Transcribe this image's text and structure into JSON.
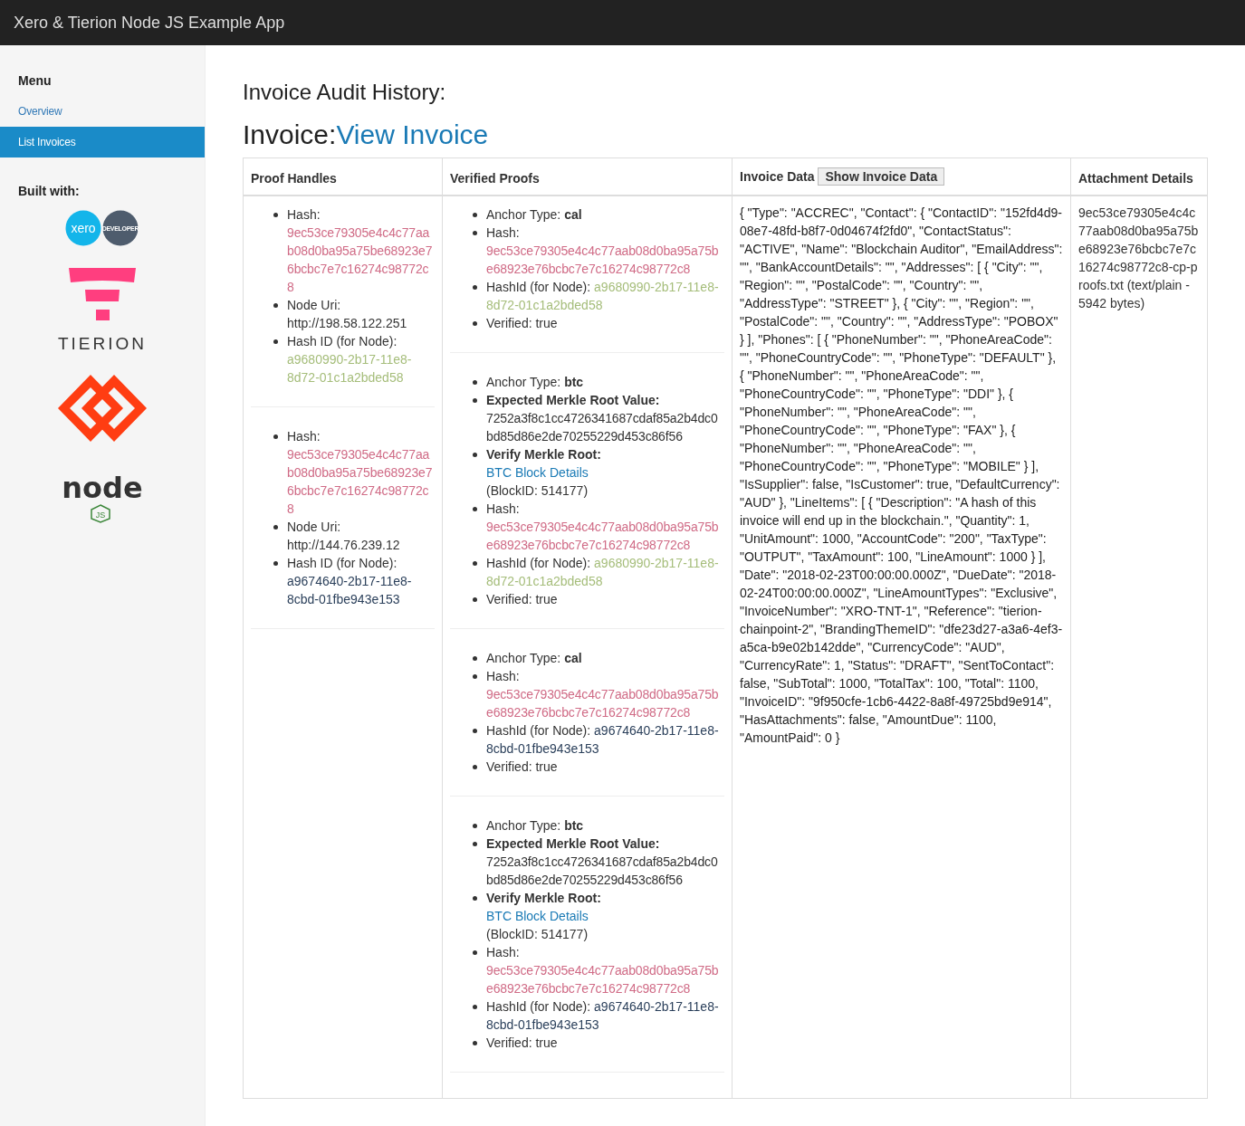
{
  "app_bar": {
    "title": "Xero & Tierion Node JS Example App"
  },
  "sidebar": {
    "menu_heading": "Menu",
    "items": [
      {
        "label": "Overview",
        "selected": false
      },
      {
        "label": "List Invoices",
        "selected": true
      }
    ],
    "built_with_heading": "Built with:",
    "logos": [
      {
        "kind": "xero",
        "text": "xero",
        "badge": "DEVELOPER"
      },
      {
        "kind": "tierion",
        "text": "TIERION"
      },
      {
        "kind": "chainpoint"
      },
      {
        "kind": "node",
        "text": "node",
        "badge": "JS"
      }
    ]
  },
  "heading": "Invoice Audit History:",
  "invoice_heading": {
    "label": "Invoice:",
    "link": "View Invoice"
  },
  "table": {
    "columns": [
      "Proof Handles",
      "Verified Proofs",
      "Invoice Data",
      "Attachment Details"
    ],
    "show_button": "Show Invoice Data",
    "proof_handles": [
      {
        "lines": [
          {
            "kind": "hash",
            "label": "Hash:",
            "value": "9ec53ce79305e4c4c77aab08d0ba95a75be68923e76bcbc7e7c16274c98772c8"
          },
          {
            "kind": "node_uri",
            "label": "Node Uri:",
            "value": "http://198.58.122.251"
          },
          {
            "kind": "hash_id",
            "label": "Hash ID (for Node):",
            "value": "a9680990-2b17-11e8-8d72-01c1a2bded58",
            "highlighted": true
          }
        ]
      },
      {
        "lines": [
          {
            "kind": "hash",
            "label": "Hash:",
            "value": "9ec53ce79305e4c4c77aab08d0ba95a75be68923e76bcbc7e7c16274c98772c8"
          },
          {
            "kind": "node_uri",
            "label": "Node Uri:",
            "value": "http://144.76.239.12"
          },
          {
            "kind": "hash_id",
            "label": "Hash ID (for Node):",
            "value": "a9674640-2b17-11e8-8cbd-01fbe943e153",
            "highlighted": false
          }
        ]
      }
    ],
    "verified_proofs": [
      {
        "lines": [
          {
            "kind": "anchor",
            "text": "Anchor Type: **cal**"
          },
          {
            "kind": "hash",
            "label": "Hash:",
            "value": "9ec53ce79305e4c4c77aab08d0ba95a75be68923e76bcbc7e7c16274c98772c8"
          },
          {
            "kind": "hash_id",
            "label": "HashId (for Node):",
            "value": "a9680990-2b17-11e8-8d72-01c1a2bded58",
            "highlighted": true
          },
          {
            "kind": "verified",
            "text": "Verified: true"
          }
        ]
      },
      {
        "lines": [
          {
            "kind": "anchor",
            "text": "Anchor Type: **btc**"
          },
          {
            "kind": "merkle_value",
            "label": "Expected Merkle Root Value:",
            "value": "7252a3f8c1cc4726341687cdaf85a2b4dc0bd85d86e2de70255229d453c86f56"
          },
          {
            "kind": "merkle_verify",
            "label": "Verify Merkle Root:",
            "link": "BTC Block Details",
            "block": "(BlockID: 514177)"
          },
          {
            "kind": "hash",
            "label": "Hash:",
            "value": "9ec53ce79305e4c4c77aab08d0ba95a75be68923e76bcbc7e7c16274c98772c8"
          },
          {
            "kind": "hash_id",
            "label": "HashId (for Node):",
            "value": "a9680990-2b17-11e8-8d72-01c1a2bded58",
            "highlighted": true
          },
          {
            "kind": "verified",
            "text": "Verified: true"
          }
        ]
      },
      {
        "lines": [
          {
            "kind": "anchor",
            "text": "Anchor Type: **cal**"
          },
          {
            "kind": "hash",
            "label": "Hash:",
            "value": "9ec53ce79305e4c4c77aab08d0ba95a75be68923e76bcbc7e7c16274c98772c8"
          },
          {
            "kind": "hash_id",
            "label": "HashId (for Node):",
            "value": "a9674640-2b17-11e8-8cbd-01fbe943e153",
            "highlighted": false
          },
          {
            "kind": "verified",
            "text": "Verified: true"
          }
        ]
      },
      {
        "lines": [
          {
            "kind": "anchor",
            "text": "Anchor Type: **btc**"
          },
          {
            "kind": "merkle_value",
            "label": "Expected Merkle Root Value:",
            "value": "7252a3f8c1cc4726341687cdaf85a2b4dc0bd85d86e2de70255229d453c86f56"
          },
          {
            "kind": "merkle_verify",
            "label": "Verify Merkle Root:",
            "link": "BTC Block Details",
            "block": "(BlockID: 514177)"
          },
          {
            "kind": "hash",
            "label": "Hash:",
            "value": "9ec53ce79305e4c4c77aab08d0ba95a75be68923e76bcbc7e7c16274c98772c8"
          },
          {
            "kind": "hash_id",
            "label": "HashId (for Node):",
            "value": "a9674640-2b17-11e8-8cbd-01fbe943e153",
            "highlighted": false
          },
          {
            "kind": "verified",
            "text": "Verified: true"
          }
        ]
      }
    ],
    "invoice_data": "{ \"Type\": \"ACCREC\", \"Contact\": { \"ContactID\": \"152fd4d9-08e7-48fd-b8f7-0d04674f2fd0\", \"ContactStatus\": \"ACTIVE\", \"Name\": \"Blockchain Auditor\", \"EmailAddress\": \"\", \"BankAccountDetails\": \"\", \"Addresses\": [ { \"City\": \"\", \"Region\": \"\", \"PostalCode\": \"\", \"Country\": \"\", \"AddressType\": \"STREET\" }, { \"City\": \"\", \"Region\": \"\", \"PostalCode\": \"\", \"Country\": \"\", \"AddressType\": \"POBOX\" } ], \"Phones\": [ { \"PhoneNumber\": \"\", \"PhoneAreaCode\": \"\", \"PhoneCountryCode\": \"\", \"PhoneType\": \"DEFAULT\" }, { \"PhoneNumber\": \"\", \"PhoneAreaCode\": \"\", \"PhoneCountryCode\": \"\", \"PhoneType\": \"DDI\" }, { \"PhoneNumber\": \"\", \"PhoneAreaCode\": \"\", \"PhoneCountryCode\": \"\", \"PhoneType\": \"FAX\" }, { \"PhoneNumber\": \"\", \"PhoneAreaCode\": \"\", \"PhoneCountryCode\": \"\", \"PhoneType\": \"MOBILE\" } ], \"IsSupplier\": false, \"IsCustomer\": true, \"DefaultCurrency\": \"AUD\" }, \"LineItems\": [ { \"Description\": \"A hash of this invoice will end up in the blockchain.\", \"Quantity\": 1, \"UnitAmount\": 1000, \"AccountCode\": \"200\", \"TaxType\": \"OUTPUT\", \"TaxAmount\": 100, \"LineAmount\": 1000 } ], \"Date\": \"2018-02-23T00:00:00.000Z\", \"DueDate\": \"2018-02-24T00:00:00.000Z\", \"LineAmountTypes\": \"Exclusive\", \"InvoiceNumber\": \"XRO-TNT-1\", \"Reference\": \"tierion-chainpoint-2\", \"BrandingThemeID\": \"dfe23d27-a3a6-4ef3-a5ca-b9e02b142dde\", \"CurrencyCode\": \"AUD\", \"CurrencyRate\": 1, \"Status\": \"DRAFT\", \"SentToContact\": false, \"SubTotal\": 1000, \"TotalTax\": 100, \"Total\": 1100, \"InvoiceID\": \"9f950cfe-1cb6-4422-8a8f-49725bd9e914\", \"HasAttachments\": false, \"AmountDue\": 1100, \"AmountPaid\": 0 }",
    "attachment": "9ec53ce79305e4c4c77aab08d0ba95a75be68923e76bcbc7e7c16274c98772c8-cp-proofs.txt (text/plain - 5942 bytes)"
  }
}
